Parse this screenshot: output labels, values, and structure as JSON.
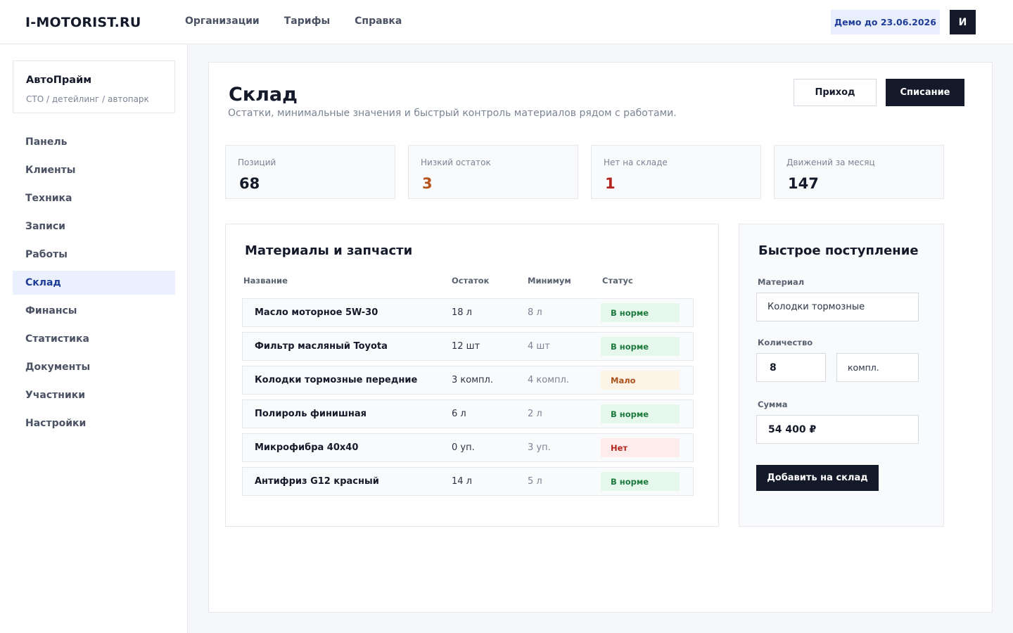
{
  "topbar": {
    "logo": "I-MOTORIST.RU",
    "nav": [
      "Организации",
      "Тарифы",
      "Справка"
    ],
    "demo_badge": "Демо до 23.06.2026",
    "avatar_initial": "И"
  },
  "sidebar": {
    "org_name": "АвтоПрайм",
    "org_sub": "СТО / детейлинг / автопарк",
    "items": [
      "Панель",
      "Клиенты",
      "Техника",
      "Записи",
      "Работы",
      "Склад",
      "Финансы",
      "Статистика",
      "Документы",
      "Участники",
      "Настройки"
    ],
    "active_index": 5
  },
  "page": {
    "title": "Склад",
    "subtitle": "Остатки, минимальные значения и быстрый контроль материалов рядом с работами.",
    "btn_income": "Приход",
    "btn_writeoff": "Списание"
  },
  "stats": [
    {
      "label": "Позиций",
      "value": "68",
      "color": "#141a29"
    },
    {
      "label": "Низкий остаток",
      "value": "3",
      "color": "#b4541c"
    },
    {
      "label": "Нет на складе",
      "value": "1",
      "color": "#b3261e"
    },
    {
      "label": "Движений за месяц",
      "value": "147",
      "color": "#141a29"
    }
  ],
  "materials": {
    "title": "Материалы и запчасти",
    "columns": [
      "Название",
      "Остаток",
      "Минимум",
      "Статус"
    ],
    "rows": [
      {
        "name": "Масло моторное 5W-30",
        "stock": "18 л",
        "min": "8 л",
        "status": "В норме",
        "status_type": "ok"
      },
      {
        "name": "Фильтр масляный Toyota",
        "stock": "12 шт",
        "min": "4 шт",
        "status": "В норме",
        "status_type": "ok"
      },
      {
        "name": "Колодки тормозные передние",
        "stock": "3 компл.",
        "min": "4 компл.",
        "status": "Мало",
        "status_type": "low"
      },
      {
        "name": "Полироль финишная",
        "stock": "6 л",
        "min": "2 л",
        "status": "В норме",
        "status_type": "ok"
      },
      {
        "name": "Микрофибра 40x40",
        "stock": "0 уп.",
        "min": "3 уп.",
        "status": "Нет",
        "status_type": "none"
      },
      {
        "name": "Антифриз G12 красный",
        "stock": "14 л",
        "min": "5 л",
        "status": "В норме",
        "status_type": "ok"
      }
    ]
  },
  "quick": {
    "title": "Быстрое поступление",
    "material_label": "Материал",
    "material_value": "Колодки тормозные",
    "quantity_label": "Количество",
    "quantity_value": "8",
    "unit_value": "компл.",
    "sum_label": "Сумма",
    "sum_value": "54 400 ₽",
    "add_button": "Добавить на склад"
  }
}
